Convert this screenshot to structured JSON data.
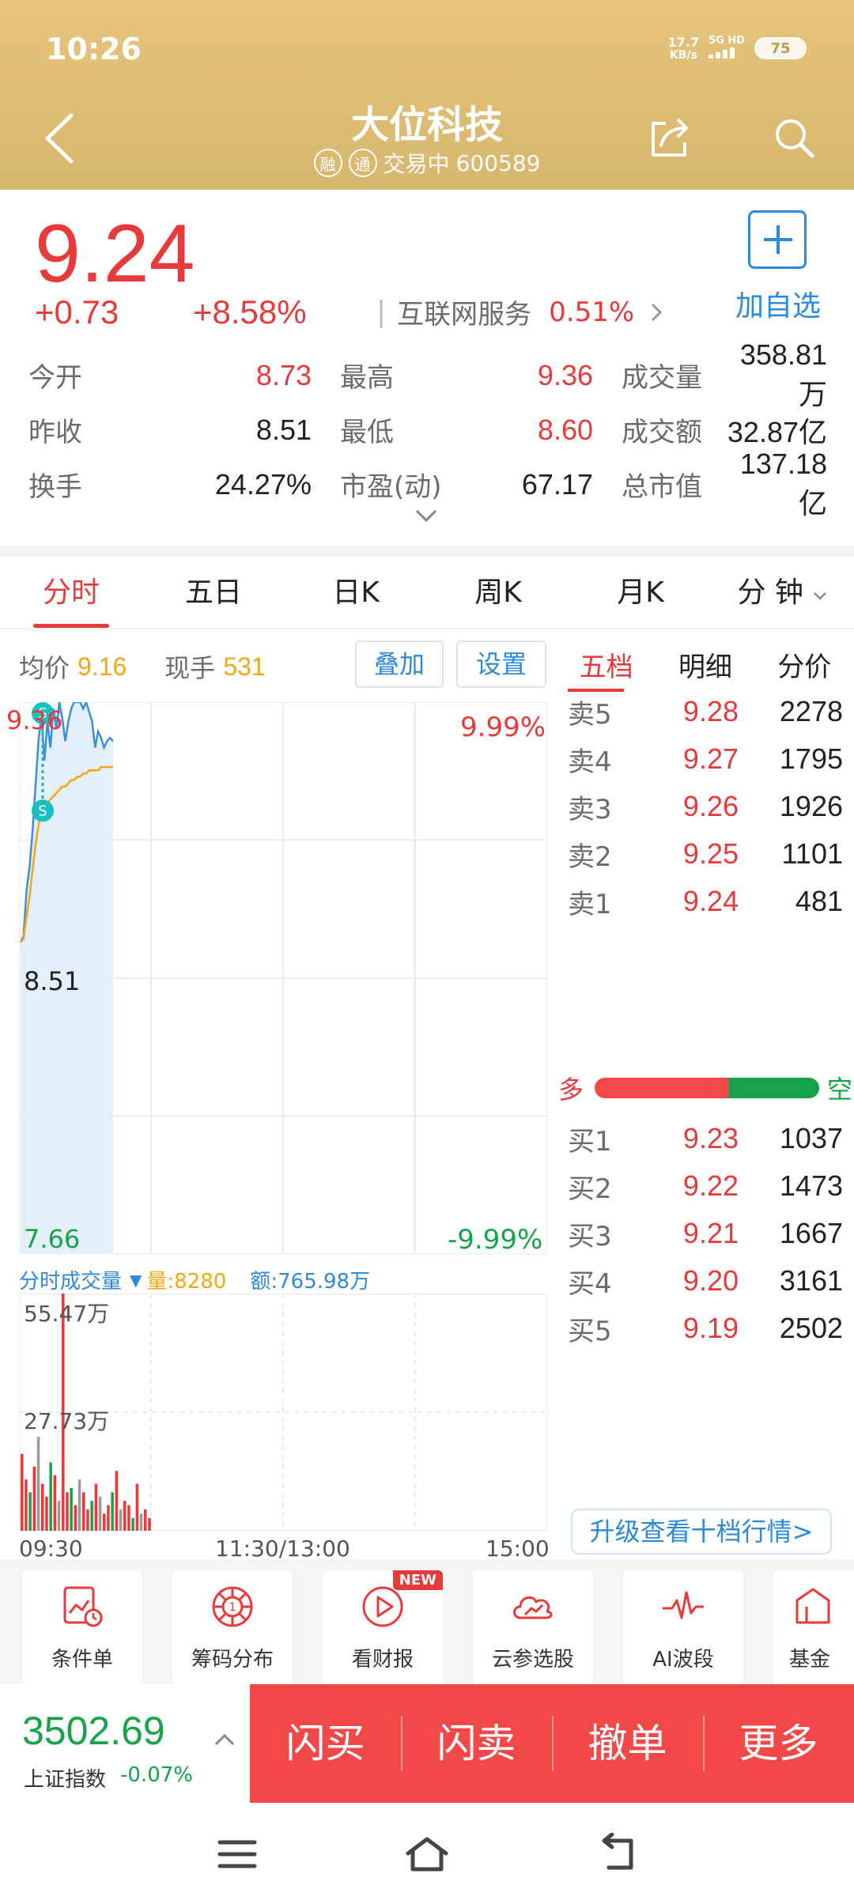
{
  "status_bar": {
    "time": "10:26",
    "net_speed_value": "17.7",
    "net_speed_unit": "KB/s",
    "network": "5G HD",
    "battery": "75"
  },
  "header": {
    "title": "大位科技",
    "tag_rong": "融",
    "tag_tong": "通",
    "status": "交易中",
    "code": "600589"
  },
  "quote": {
    "price": "9.24",
    "change": "+0.73",
    "change_pct": "+8.58%",
    "sector_name": "互联网服务",
    "sector_pct": "0.51%",
    "add_label": "加自选",
    "stats": {
      "open_label": "今开",
      "open": "8.73",
      "high_label": "最高",
      "high": "9.36",
      "volume_label": "成交量",
      "volume": "358.81万",
      "prev_close_label": "昨收",
      "prev_close": "8.51",
      "low_label": "最低",
      "low": "8.60",
      "amount_label": "成交额",
      "amount": "32.87亿",
      "turnover_label": "换手",
      "turnover": "24.27%",
      "pe_label": "市盈(动)",
      "pe": "67.17",
      "market_cap_label": "总市值",
      "market_cap": "137.18亿"
    }
  },
  "chart_tabs": [
    "分时",
    "五日",
    "日K",
    "周K",
    "月K",
    "分 钟"
  ],
  "intraday": {
    "avg_label": "均价",
    "avg": "9.16",
    "cur_label": "现手",
    "cur": "531",
    "overlay_btn": "叠加",
    "setting_btn": "设置",
    "axis_high": "9.36",
    "axis_mid": "8.51",
    "axis_low": "7.66",
    "pct_high": "9.99%",
    "pct_low": "-9.99%",
    "marker_buy": "S",
    "marker_sell": "S",
    "vol_title": "分时成交量",
    "vol_qty": "量:8280",
    "vol_amt": "额:765.98万",
    "vol_max": "55.47万",
    "vol_mid": "27.73万",
    "time_start": "09:30",
    "time_mid": "11:30/13:00",
    "time_end": "15:00"
  },
  "chart_data": {
    "type": "line",
    "series": [
      {
        "values": [
          8.62,
          8.64,
          8.78,
          8.85,
          8.96,
          9.1,
          9.24,
          9.32,
          9.18,
          9.3,
          9.22,
          9.34,
          9.28,
          9.36,
          9.31,
          9.24,
          9.3,
          9.34,
          9.36,
          9.36,
          9.36,
          9.34,
          9.36,
          9.33,
          9.3,
          9.22,
          9.27,
          9.25,
          9.22,
          9.24,
          9.25,
          9.24
        ]
      },
      {
        "values": [
          8.62,
          8.63,
          8.7,
          8.76,
          8.84,
          8.92,
          8.98,
          9.02,
          9.03,
          9.05,
          9.06,
          9.07,
          9.08,
          9.09,
          9.1,
          9.1,
          9.11,
          9.12,
          9.12,
          9.13,
          9.13,
          9.14,
          9.14,
          9.15,
          9.15,
          9.15,
          9.15,
          9.16,
          9.16,
          9.16,
          9.16,
          9.16
        ]
      }
    ],
    "ylim": [
      7.66,
      9.36
    ],
    "volume_ylim": [
      0,
      554700
    ],
    "volume": [
      180000,
      120000,
      90000,
      150000,
      220000,
      110000,
      80000,
      160000,
      130000,
      70000,
      554700,
      90000,
      100000,
      60000,
      120000,
      90000,
      50000,
      70000,
      110000,
      80000,
      40000,
      60000,
      90000,
      140000,
      50000,
      70000,
      60000,
      30000,
      110000,
      40000,
      50000,
      30000
    ]
  },
  "order_book": {
    "tabs": [
      "五档",
      "明细",
      "分价"
    ],
    "asks": [
      {
        "label": "卖5",
        "price": "9.28",
        "vol": "2278"
      },
      {
        "label": "卖4",
        "price": "9.27",
        "vol": "1795"
      },
      {
        "label": "卖3",
        "price": "9.26",
        "vol": "1926"
      },
      {
        "label": "卖2",
        "price": "9.25",
        "vol": "1101"
      },
      {
        "label": "卖1",
        "price": "9.24",
        "vol": "481"
      }
    ],
    "bids": [
      {
        "label": "买1",
        "price": "9.23",
        "vol": "1037"
      },
      {
        "label": "买2",
        "price": "9.22",
        "vol": "1473"
      },
      {
        "label": "买3",
        "price": "9.21",
        "vol": "1667"
      },
      {
        "label": "买4",
        "price": "9.20",
        "vol": "3161"
      },
      {
        "label": "买5",
        "price": "9.19",
        "vol": "2502"
      }
    ],
    "duo": "多",
    "kong": "空",
    "buy_ratio": 0.6,
    "upgrade": "升级查看十档行情>"
  },
  "features": [
    {
      "label": "条件单",
      "icon": "condition-order-icon"
    },
    {
      "label": "筹码分布",
      "icon": "chip-distribution-icon"
    },
    {
      "label": "看财报",
      "icon": "play-report-icon",
      "badge": "NEW"
    },
    {
      "label": "云参选股",
      "icon": "cloud-chart-icon"
    },
    {
      "label": "AI波段",
      "icon": "pulse-wave-icon"
    },
    {
      "label": "基金",
      "icon": "fund-icon"
    }
  ],
  "bottom": {
    "index_value": "3502.69",
    "index_name": "上证指数",
    "index_pct": "-0.07%",
    "trade_buttons": [
      "闪买",
      "闪卖",
      "撤单",
      "更多"
    ]
  },
  "colors": {
    "header_gold": "#dcbb72",
    "up_red": "#e8393b",
    "down_green": "#16a34a",
    "accent_blue": "#2e8ad6",
    "avg_orange": "#f3a716"
  }
}
